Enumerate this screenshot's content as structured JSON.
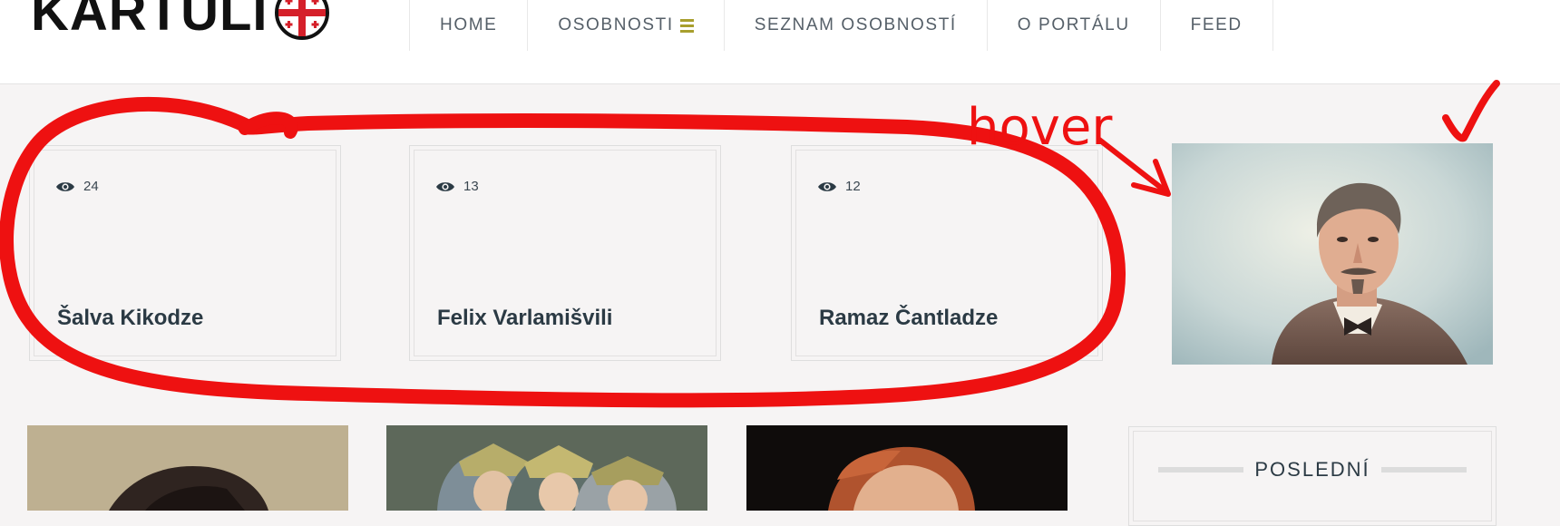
{
  "header": {
    "logo_text": "KARTULI",
    "nav": [
      {
        "label": "HOME"
      },
      {
        "label": "OSOBNOSTI",
        "has_menu_icon": true
      },
      {
        "label": "SEZNAM OSOBNOSTÍ"
      },
      {
        "label": "O PORTÁLU"
      },
      {
        "label": "FEED"
      }
    ]
  },
  "cards": [
    {
      "views": "24",
      "name": "Šalva Kikodze"
    },
    {
      "views": "13",
      "name": "Felix Varlamišvili"
    },
    {
      "views": "12",
      "name": "Ramaz Čantladze"
    }
  ],
  "sidebar": {
    "widget_title": "POSLEDNÍ"
  },
  "annotation": {
    "hover_label": "hover",
    "color": "#ee1111"
  },
  "colors": {
    "background": "#f6f4f4",
    "accent": "#a89f2e",
    "text": "#2b3a44"
  }
}
